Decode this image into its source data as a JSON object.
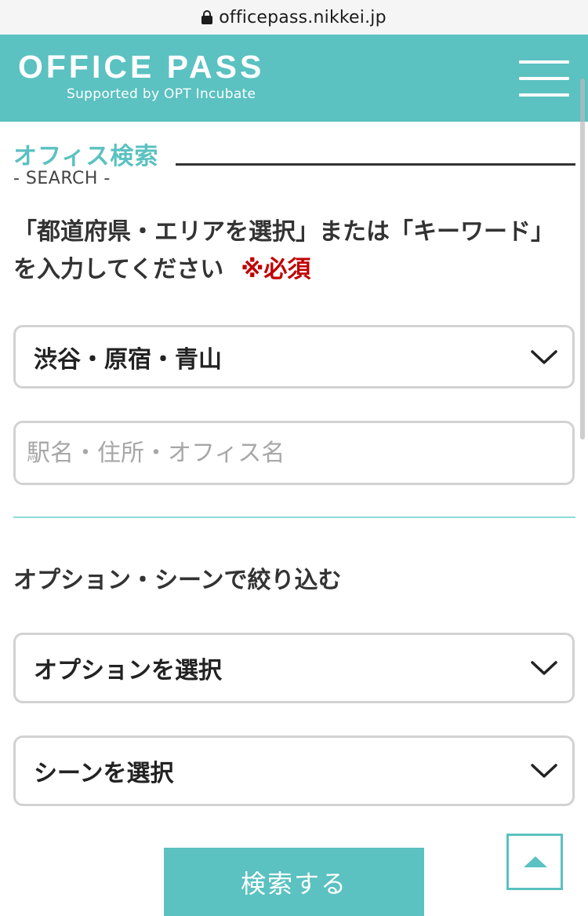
{
  "browser": {
    "url": "officepass.nikkei.jp",
    "lock_icon": "lock-icon"
  },
  "header": {
    "logo_title": "OFFICE PASS",
    "logo_subtitle": "Supported by OPT Incubate",
    "menu_icon": "hamburger-menu-icon",
    "background_color": "#5bc1c1"
  },
  "search": {
    "title": "オフィス検索",
    "subtitle": "- SEARCH -",
    "instruction": "「都道府県・エリアを選択」または「キーワード」を入力してください",
    "required_label": "※必須",
    "area_select": {
      "selected": "渋谷・原宿・青山",
      "icon": "chevron-down-icon"
    },
    "keyword_input": {
      "value": "",
      "placeholder": "駅名・住所・オフィス名"
    }
  },
  "filters": {
    "heading": "オプション・シーンで絞り込む",
    "option_select": {
      "selected": "オプションを選択",
      "icon": "chevron-down-icon"
    },
    "scene_select": {
      "selected": "シーンを選択",
      "icon": "chevron-down-icon"
    }
  },
  "actions": {
    "search_button": "検索する",
    "back_to_top_icon": "arrow-up-icon"
  },
  "colors": {
    "accent": "#5bc1c1",
    "required": "#c00000",
    "divider": "#8edcdc"
  }
}
